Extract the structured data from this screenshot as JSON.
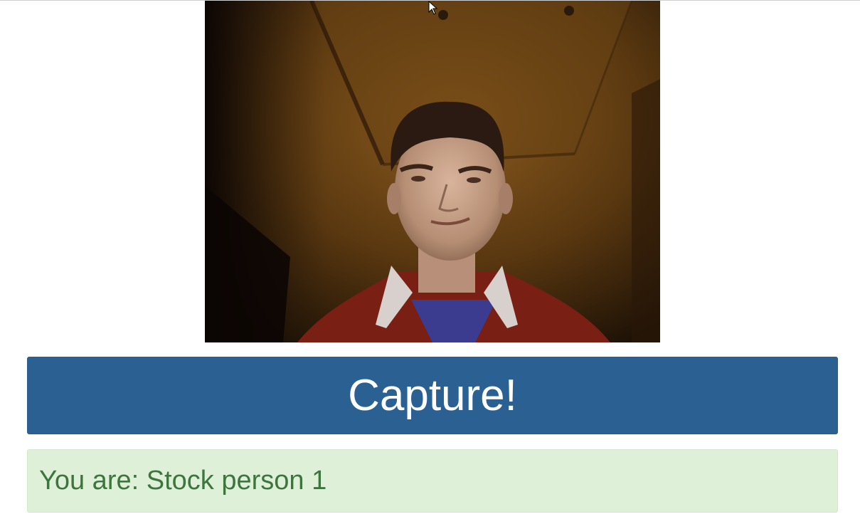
{
  "webcam": {
    "feed_name": "webcam-video-feed"
  },
  "capture": {
    "label": "Capture!"
  },
  "result": {
    "prefix": "You are: ",
    "name": "Stock person 1"
  },
  "colors": {
    "primary_button": "#2b6192",
    "success_background": "#dff0d8",
    "success_text": "#3c763d"
  },
  "icons": {
    "cursor": "mouse-pointer-icon"
  }
}
